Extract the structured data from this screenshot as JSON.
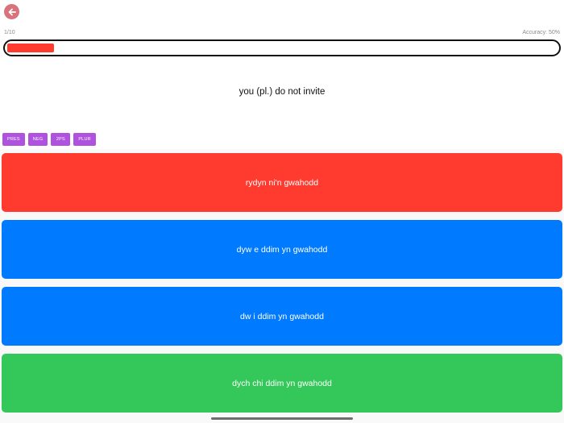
{
  "header": {
    "back_icon": "arrow-left-icon",
    "back_color": "#d9737b"
  },
  "progress": {
    "counter": "1/10",
    "accuracy": "Accuracy: 50%",
    "fill_fraction": 0.1,
    "fill_color": "#ff3b30"
  },
  "question": {
    "prompt": "you (pl.) do not invite"
  },
  "tags": [
    "PRES",
    "NEG",
    "2PS",
    "PLUR"
  ],
  "tag_color": "#af52de",
  "answers": [
    {
      "text": "rydyn ni'n gwahodd",
      "color": "#ff3b30"
    },
    {
      "text": "dyw e ddim yn gwahodd",
      "color": "#007aff"
    },
    {
      "text": "dw i ddim yn gwahodd",
      "color": "#007aff"
    },
    {
      "text": "dych chi ddim yn gwahodd",
      "color": "#34c759"
    }
  ]
}
